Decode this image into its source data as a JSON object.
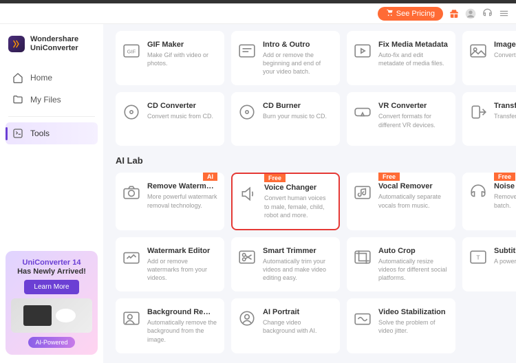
{
  "header": {
    "see_pricing": "See Pricing"
  },
  "brand": {
    "line1": "Wondershare",
    "line2": "UniConverter"
  },
  "nav": {
    "home": "Home",
    "files": "My Files",
    "tools": "Tools"
  },
  "promo": {
    "title": "UniConverter 14",
    "sub": "Has Newly Arrived!",
    "btn": "Learn More",
    "badge": "AI-Powered"
  },
  "section": {
    "ailab": "AI Lab"
  },
  "cards_top": [
    {
      "title": "GIF Maker",
      "desc": "Make Gif with video or photos."
    },
    {
      "title": "Intro & Outro",
      "desc": "Add or remove the beginning and end of your video batch."
    },
    {
      "title": "Fix Media Metadata",
      "desc": "Auto-fix and edit metadate of media files."
    },
    {
      "title": "Image C",
      "desc": "Convert i\nformats."
    }
  ],
  "cards_mid": [
    {
      "title": "CD Converter",
      "desc": "Convert music from CD."
    },
    {
      "title": "CD Burner",
      "desc": "Burn your music to CD."
    },
    {
      "title": "VR Converter",
      "desc": "Convert formats for different VR devices."
    },
    {
      "title": "Transfer",
      "desc": "Transfer y\ndevice."
    }
  ],
  "cards_ai1": [
    {
      "title": "Remove Watermark ...",
      "desc": "More powerful watermark removal technology.",
      "badge": "AI"
    },
    {
      "title": "Voice Changer",
      "desc": "Convert human voices to male, female, child, robot and more.",
      "badge": "Free",
      "hl": true
    },
    {
      "title": "Vocal Remover",
      "desc": "Automatically separate vocals from music.",
      "badge": "Free"
    },
    {
      "title": "Noise R",
      "desc": "Remove t\nnoise fro\nbatch.",
      "badge": "Free"
    }
  ],
  "cards_ai2": [
    {
      "title": "Watermark Editor",
      "desc": "Add or remove watermarks from your videos."
    },
    {
      "title": "Smart Trimmer",
      "desc": "Automatically trim your videos and make video editing easy."
    },
    {
      "title": "Auto Crop",
      "desc": "Automatically resize videos for different social platforms."
    },
    {
      "title": "Subtitle",
      "desc": "A powerf\nediting to"
    }
  ],
  "cards_ai3": [
    {
      "title": "Background Remover",
      "desc": "Automatically remove the background from the image."
    },
    {
      "title": "AI   Portrait",
      "desc": "Change video background with AI."
    },
    {
      "title": "Video Stabilization",
      "desc": "Solve the problem of video jitter."
    }
  ]
}
